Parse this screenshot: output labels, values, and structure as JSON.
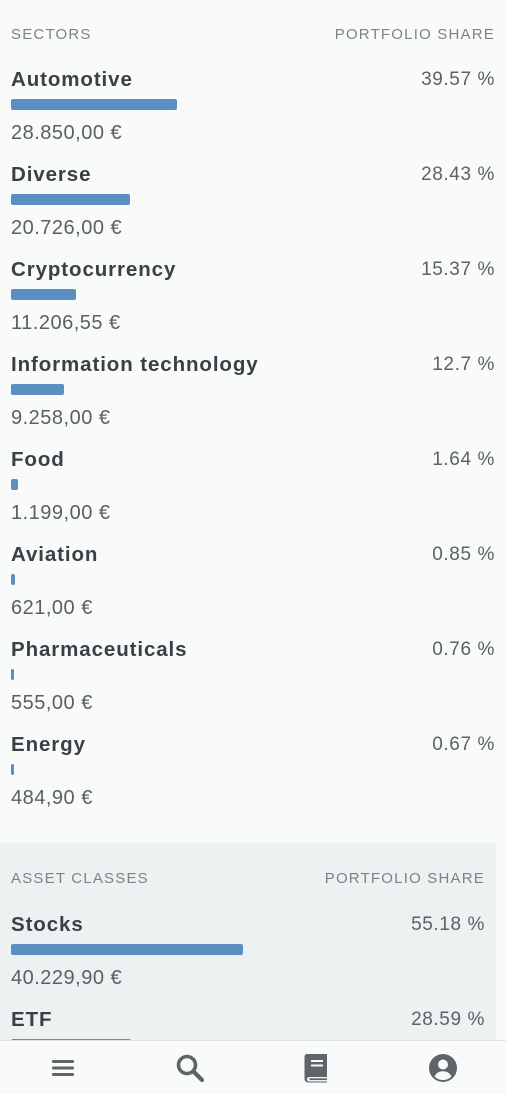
{
  "sectors": {
    "header_left": "SECTORS",
    "header_right": "PORTFOLIO SHARE",
    "items": [
      {
        "name": "Automotive",
        "pct": "39.57 %",
        "value": "28.850,00 €",
        "share": 39.57
      },
      {
        "name": "Diverse",
        "pct": "28.43 %",
        "value": "20.726,00 €",
        "share": 28.43
      },
      {
        "name": "Cryptocurrency",
        "pct": "15.37 %",
        "value": "11.206,55 €",
        "share": 15.37
      },
      {
        "name": "Information technology",
        "pct": "12.7 %",
        "value": "9.258,00 €",
        "share": 12.7
      },
      {
        "name": "Food",
        "pct": "1.64 %",
        "value": "1.199,00 €",
        "share": 1.64
      },
      {
        "name": "Aviation",
        "pct": "0.85 %",
        "value": "621,00 €",
        "share": 0.85
      },
      {
        "name": "Pharmaceuticals",
        "pct": "0.76 %",
        "value": "555,00 €",
        "share": 0.76
      },
      {
        "name": "Energy",
        "pct": "0.67 %",
        "value": "484,90 €",
        "share": 0.67
      }
    ]
  },
  "asset_classes": {
    "header_left": "ASSET CLASSES",
    "header_right": "PORTFOLIO SHARE",
    "items": [
      {
        "name": "Stocks",
        "pct": "55.18 %",
        "value": "40.229,90 €",
        "share": 55.18
      },
      {
        "name": "ETF",
        "pct": "28.59 %",
        "value": "",
        "share": 28.59
      }
    ]
  },
  "colors": {
    "bar": "#5b8fc1",
    "nav_icon": "#5f6468"
  },
  "bottom_nav": [
    {
      "icon": "menu-icon"
    },
    {
      "icon": "search-icon"
    },
    {
      "icon": "book-icon"
    },
    {
      "icon": "account-icon"
    }
  ]
}
